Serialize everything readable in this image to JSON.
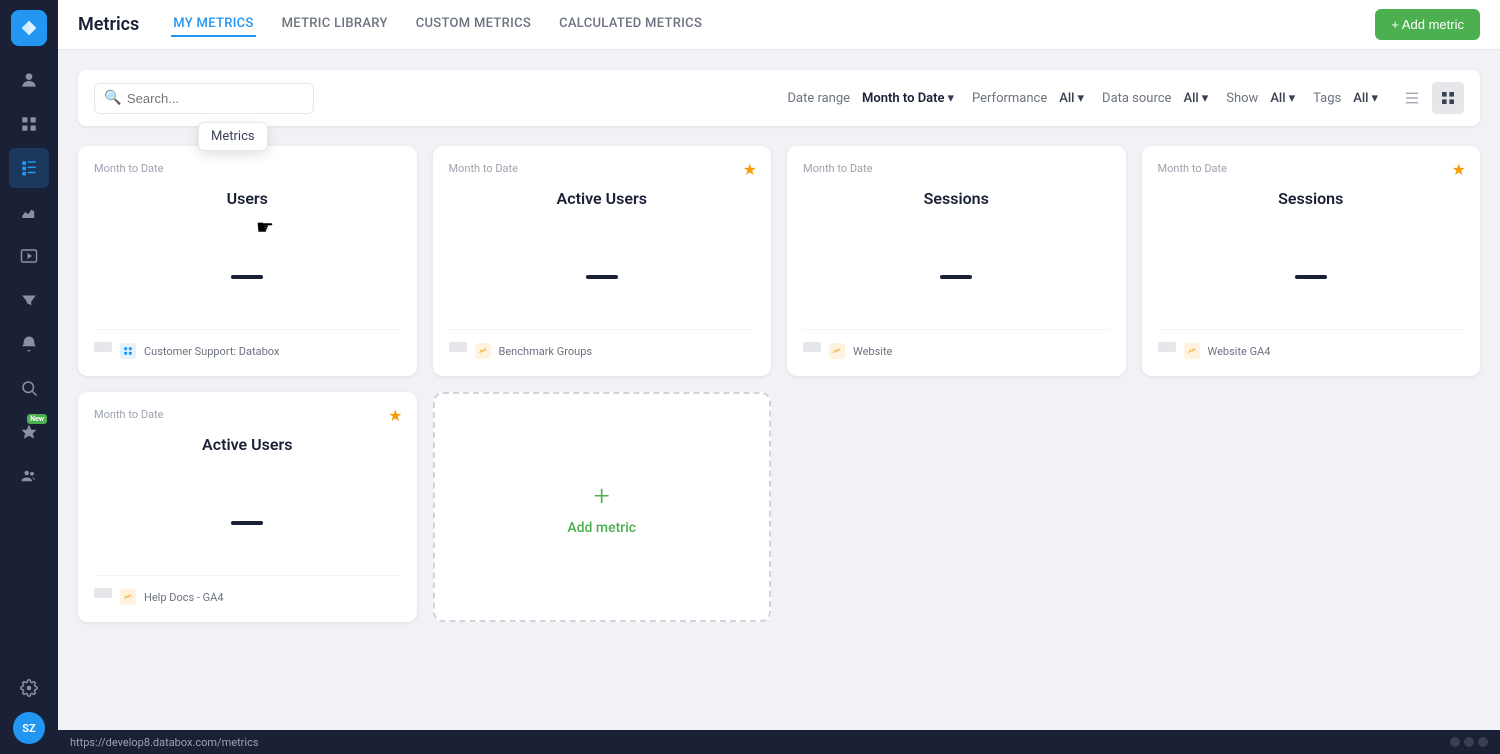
{
  "app": {
    "title": "Metrics",
    "logo_alt": "Databox"
  },
  "nav": {
    "tabs": [
      {
        "id": "my-metrics",
        "label": "MY METRICS",
        "active": true
      },
      {
        "id": "metric-library",
        "label": "METRIC LIBRARY",
        "active": false
      },
      {
        "id": "custom-metrics",
        "label": "CUSTOM METRICS",
        "active": false
      },
      {
        "id": "calculated-metrics",
        "label": "CALCULATED METRICS",
        "active": false
      }
    ],
    "add_button": "+ Add metric"
  },
  "filters": {
    "search_placeholder": "Search...",
    "date_range_label": "Date range",
    "date_range_value": "Month to Date",
    "performance_label": "Performance",
    "performance_value": "All",
    "data_source_label": "Data source",
    "data_source_value": "All",
    "show_label": "Show",
    "show_value": "All",
    "tags_label": "Tags",
    "tags_value": "All"
  },
  "cards": [
    {
      "id": "card-users",
      "date_range": "Month to Date",
      "title": "Users",
      "starred": false,
      "source_name": "Customer Support: Databox",
      "source_type": "blue"
    },
    {
      "id": "card-active-users",
      "date_range": "Month to Date",
      "title": "Active Users",
      "starred": true,
      "source_name": "Benchmark Groups",
      "source_type": "orange"
    },
    {
      "id": "card-sessions",
      "date_range": "Month to Date",
      "title": "Sessions",
      "starred": false,
      "source_name": "Website",
      "source_type": "orange"
    },
    {
      "id": "card-sessions-2",
      "date_range": "Month to Date",
      "title": "Sessions",
      "starred": true,
      "source_name": "Website GA4",
      "source_type": "orange"
    },
    {
      "id": "card-active-users-2",
      "date_range": "Month to Date",
      "title": "Active Users",
      "starred": true,
      "source_name": "Help Docs - GA4",
      "source_type": "orange"
    }
  ],
  "add_metric": {
    "plus": "+",
    "label": "Add metric"
  },
  "tooltip": {
    "text": "Metrics"
  },
  "status_bar": {
    "url": "https://develop8.databox.com/metrics"
  },
  "sidebar": {
    "items": [
      {
        "id": "dashboard",
        "icon": "⊞",
        "active": false
      },
      {
        "id": "metrics",
        "icon": "123",
        "active": true
      },
      {
        "id": "analytics",
        "icon": "📊",
        "active": false
      },
      {
        "id": "media",
        "icon": "▶",
        "active": false
      },
      {
        "id": "funnels",
        "icon": "⬡",
        "active": false
      },
      {
        "id": "alerts",
        "icon": "🔔",
        "active": false
      },
      {
        "id": "search-insights",
        "icon": "🔍",
        "active": false
      },
      {
        "id": "new-feature",
        "icon": "✦",
        "active": false,
        "badge": "New"
      },
      {
        "id": "team",
        "icon": "👥",
        "active": false
      }
    ],
    "settings_icon": "⚙",
    "avatar": "SZ"
  }
}
